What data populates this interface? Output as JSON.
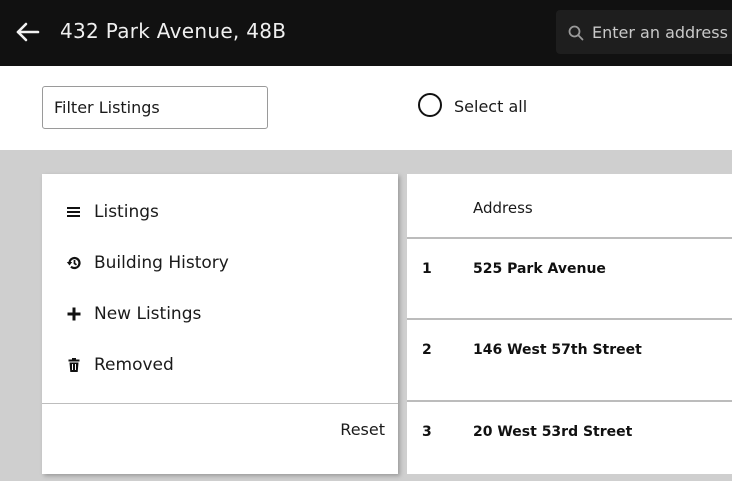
{
  "header": {
    "title": "432 Park Avenue, 48B",
    "back_icon": "arrow-left-icon",
    "search": {
      "placeholder": "Enter an address",
      "icon": "search-icon"
    }
  },
  "filters": {
    "filter_label": "Filter Listings",
    "select_all_label": "Select all"
  },
  "side_menu": {
    "items": [
      {
        "label": "Listings",
        "icon": "list-icon"
      },
      {
        "label": "Building History",
        "icon": "history-icon"
      },
      {
        "label": "New Listings",
        "icon": "plus-icon"
      },
      {
        "label": "Removed",
        "icon": "trash-icon"
      }
    ],
    "reset_label": "Reset"
  },
  "table": {
    "columns": {
      "address": "Address"
    },
    "rows": [
      {
        "num": "1",
        "address": "525 Park Avenue"
      },
      {
        "num": "2",
        "address": "146 West 57th Street"
      },
      {
        "num": "3",
        "address": "20 West 53rd Street"
      }
    ]
  },
  "colors": {
    "header_bg": "#111111",
    "page_bg": "#cfcfcf",
    "panel_bg": "#ffffff"
  }
}
